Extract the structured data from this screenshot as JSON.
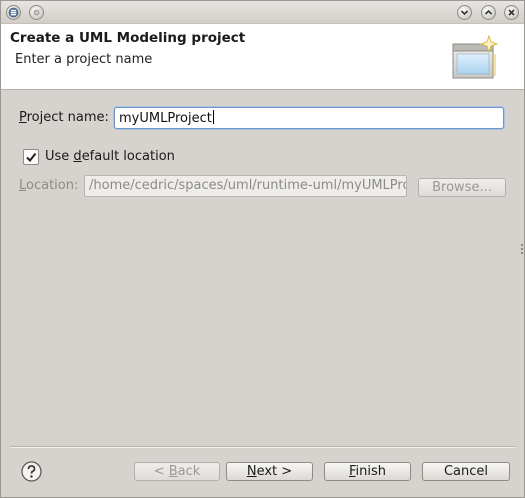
{
  "window": {
    "title_buttons": [
      "chevron-down-icon",
      "chevron-up-icon",
      "close-icon"
    ]
  },
  "header": {
    "title": "Create a UML Modeling project",
    "subtitle": "Enter a project name"
  },
  "form": {
    "project_name": {
      "label_prefix": "",
      "label_mnemonic": "P",
      "label_rest": "roject name:",
      "value": "myUMLProject"
    },
    "use_default_location": {
      "label_prefix": "Use ",
      "label_mnemonic": "d",
      "label_rest": "efault location",
      "checked": true
    },
    "location": {
      "label_prefix": "",
      "label_mnemonic": "L",
      "label_rest": "ocation:",
      "value": "/home/cedric/spaces/uml/runtime-uml/myUMLProjec",
      "enabled": false
    },
    "browse_label": "Browse..."
  },
  "footer": {
    "back": {
      "prefix": "< ",
      "mnemonic": "B",
      "rest": "ack",
      "enabled": false
    },
    "next": {
      "prefix": "",
      "mnemonic": "N",
      "rest": "ext >",
      "enabled": true
    },
    "finish": {
      "prefix": "",
      "mnemonic": "F",
      "rest": "inish",
      "enabled": true
    },
    "cancel": {
      "label": "Cancel"
    }
  },
  "colors": {
    "dialog_bg": "#d6d3ce",
    "focus_border": "#6e97c7",
    "disabled_text": "#8d8b86"
  }
}
